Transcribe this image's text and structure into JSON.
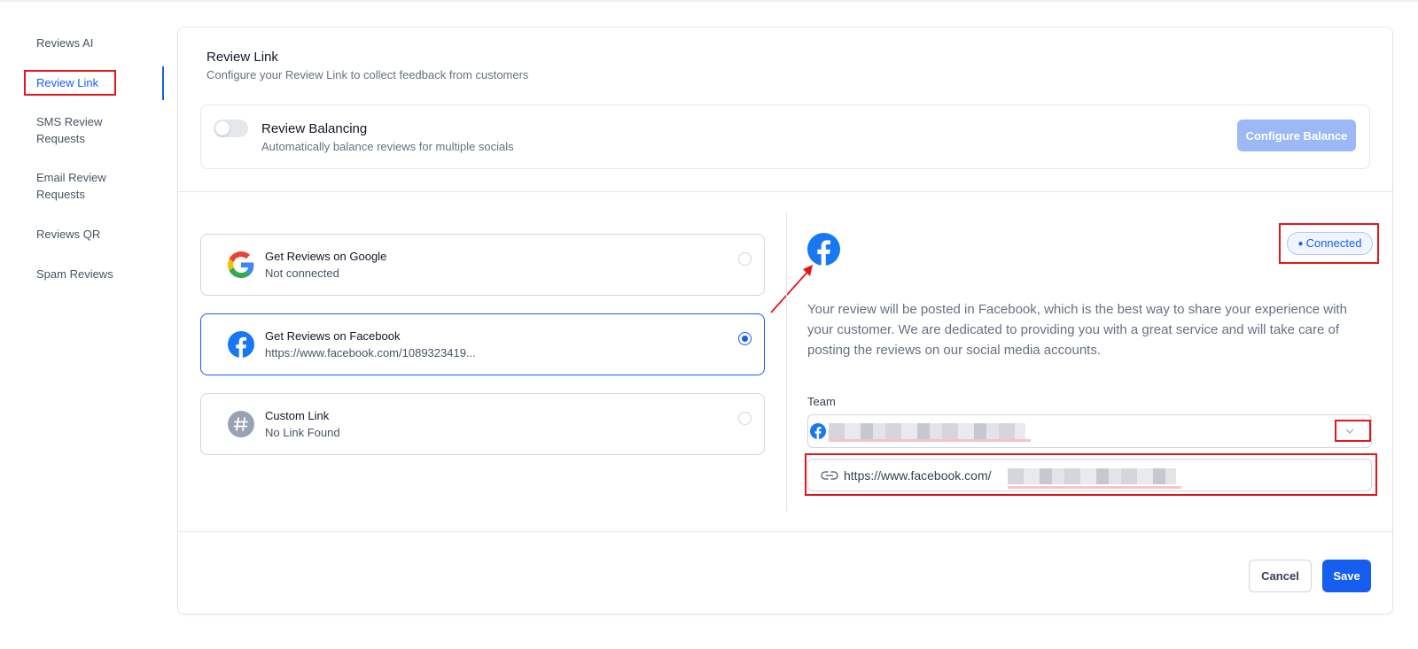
{
  "sidebar": {
    "items": [
      {
        "label": "Reviews AI"
      },
      {
        "label": "Review Link"
      },
      {
        "label": "SMS Review\nRequests"
      },
      {
        "label": "Email Review\nRequests"
      },
      {
        "label": "Reviews QR"
      },
      {
        "label": "Spam Reviews"
      }
    ],
    "active_index": 1
  },
  "header": {
    "title": "Review Link",
    "subtitle": "Configure your Review Link to collect feedback from customers"
  },
  "balancing": {
    "title": "Review Balancing",
    "subtitle": "Automatically balance reviews for multiple socials",
    "enabled": false,
    "configure_label": "Configure Balance"
  },
  "options": [
    {
      "title": "Get Reviews on Google",
      "subtitle": "Not connected",
      "icon": "google-icon",
      "selected": false
    },
    {
      "title": "Get Reviews on Facebook",
      "subtitle": "https://www.facebook.com/1089323419...",
      "icon": "facebook-icon",
      "selected": true
    },
    {
      "title": "Custom Link",
      "subtitle": "No Link Found",
      "icon": "hash-icon",
      "selected": false
    }
  ],
  "detail": {
    "status": "Connected",
    "description": "Your review will be posted in Facebook, which is the best way to share your experience with your customer. We are dedicated to providing you with a great service and will take care of posting the reviews on our social media accounts.",
    "team_label": "Team",
    "url_prefix": "https://www.facebook.com/"
  },
  "footer": {
    "cancel_label": "Cancel",
    "save_label": "Save"
  },
  "colors": {
    "accent": "#155eef",
    "annotation_red": "#e5161b",
    "facebook_blue": "#1877f2"
  }
}
